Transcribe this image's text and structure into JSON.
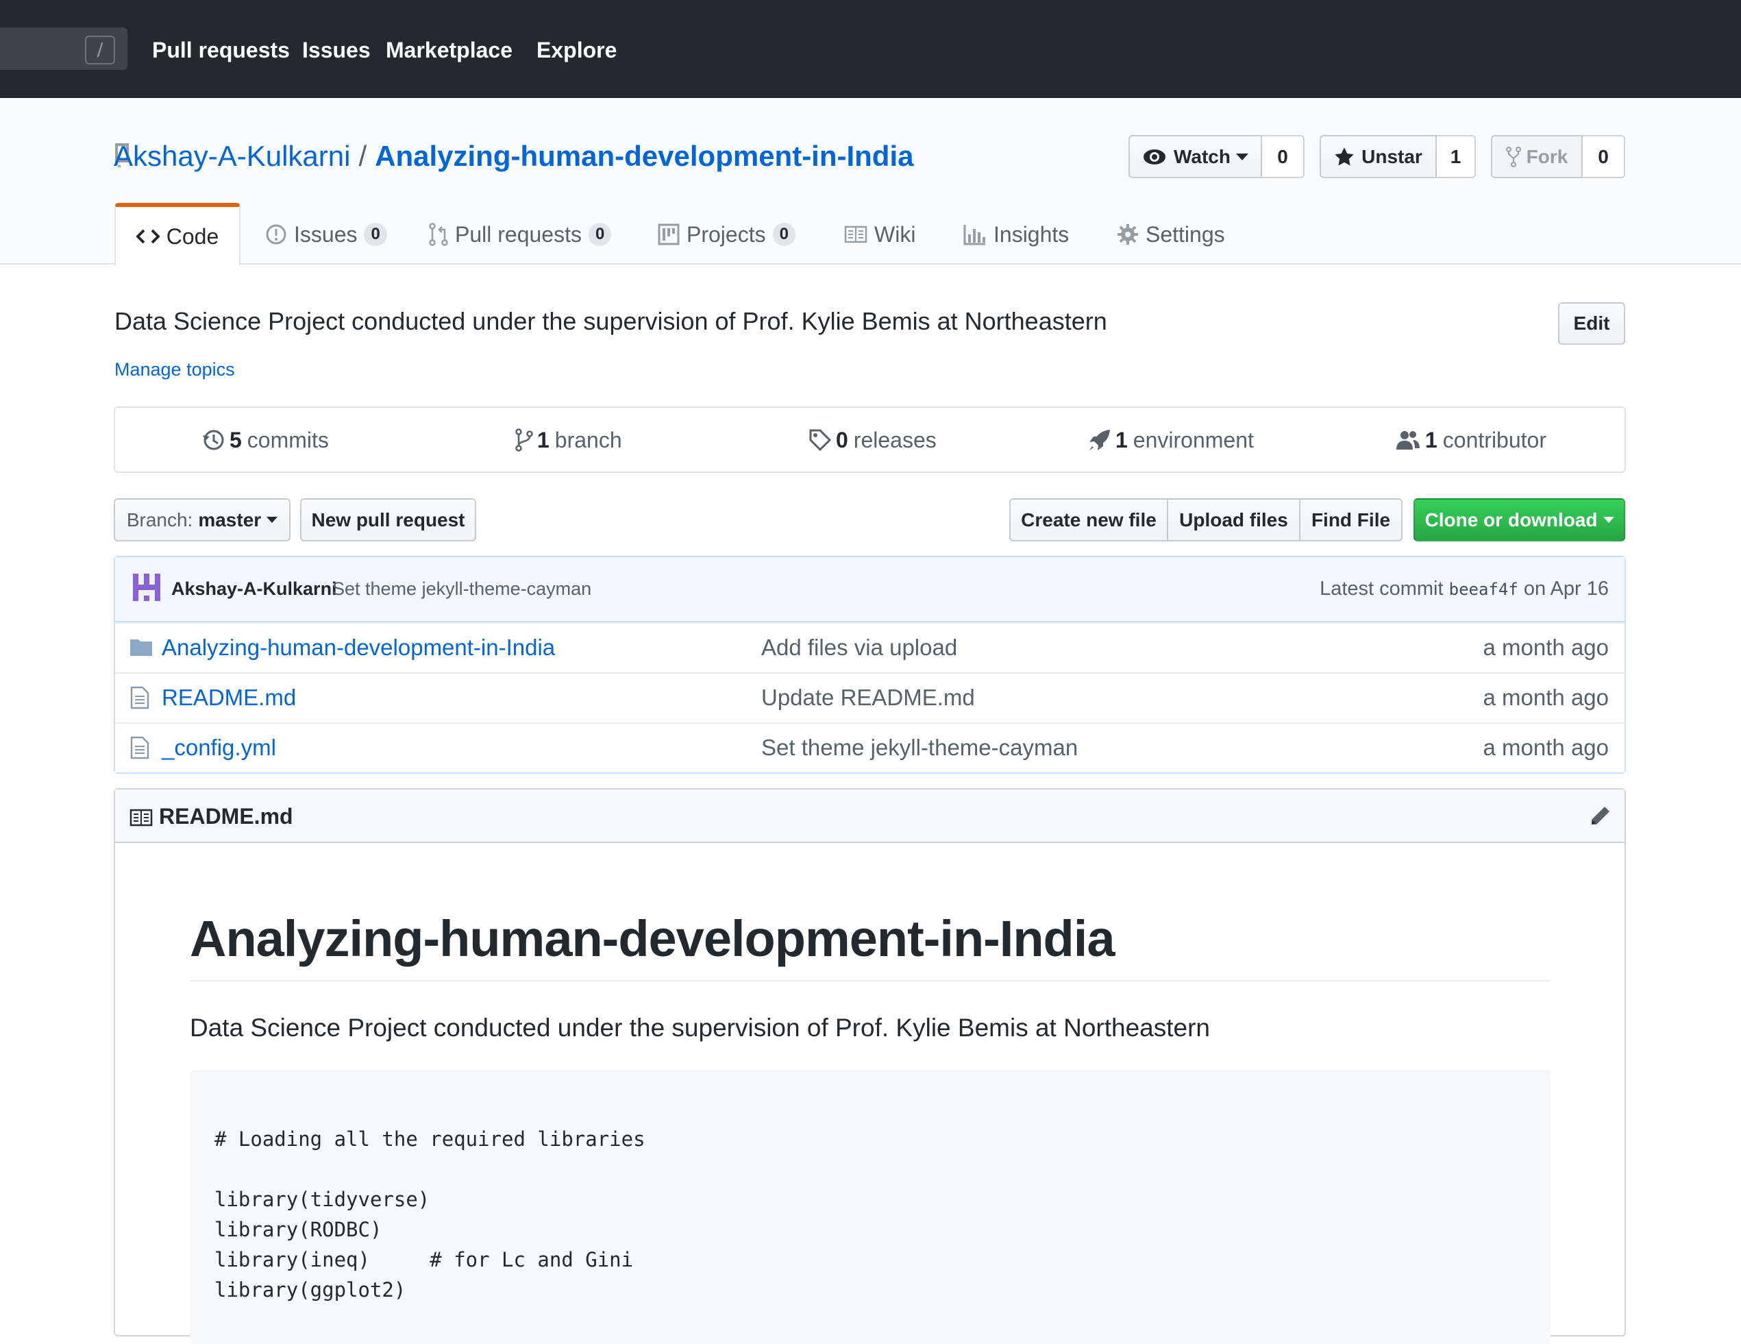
{
  "header": {
    "search_key": "/",
    "nav": [
      "Pull requests",
      "Issues",
      "Marketplace",
      "Explore"
    ]
  },
  "repo": {
    "owner": "Akshay-A-Kulkarni",
    "separator": "/",
    "name": "Analyzing-human-development-in-India",
    "watch_label": "Watch",
    "watch_count": "0",
    "star_label": "Unstar",
    "star_count": "1",
    "fork_label": "Fork",
    "fork_count": "0"
  },
  "tabs": [
    {
      "label": "Code",
      "icon": "code-icon"
    },
    {
      "label": "Issues",
      "count": "0",
      "icon": "issue-icon"
    },
    {
      "label": "Pull requests",
      "count": "0",
      "icon": "pull-request-icon"
    },
    {
      "label": "Projects",
      "count": "0",
      "icon": "project-icon"
    },
    {
      "label": "Wiki",
      "icon": "book-icon"
    },
    {
      "label": "Insights",
      "icon": "graph-icon"
    },
    {
      "label": "Settings",
      "icon": "gear-icon"
    }
  ],
  "description": "Data Science Project conducted under the supervision of Prof. Kylie Bemis at Northeastern",
  "manage_topics": "Manage topics",
  "edit_label": "Edit",
  "summary": [
    {
      "num": "5",
      "label": "commits",
      "icon": "history-icon"
    },
    {
      "num": "1",
      "label": "branch",
      "icon": "branch-icon"
    },
    {
      "num": "0",
      "label": "releases",
      "icon": "tag-icon"
    },
    {
      "num": "1",
      "label": "environment",
      "icon": "rocket-icon"
    },
    {
      "num": "1",
      "label": "contributor",
      "icon": "people-icon"
    }
  ],
  "actions": {
    "branch_prefix": "Branch:",
    "branch_name": "master",
    "new_pr": "New pull request",
    "create_file": "Create new file",
    "upload_files": "Upload files",
    "find_file": "Find File",
    "clone": "Clone or download"
  },
  "latest_commit": {
    "author": "Akshay-A-Kulkarni",
    "message": "Set theme jekyll-theme-cayman",
    "prefix": "Latest commit",
    "sha": "beeaf4f",
    "date": "on Apr 16"
  },
  "files": [
    {
      "type": "folder",
      "name": "Analyzing-human-development-in-India",
      "message": "Add files via upload",
      "age": "a month ago"
    },
    {
      "type": "file",
      "name": "README.md",
      "message": "Update README.md",
      "age": "a month ago"
    },
    {
      "type": "file",
      "name": "_config.yml",
      "message": "Set theme jekyll-theme-cayman",
      "age": "a month ago"
    }
  ],
  "readme": {
    "file_label": "README.md",
    "heading": "Analyzing-human-development-in-India",
    "paragraph": "Data Science Project conducted under the supervision of Prof. Kylie Bemis at Northeastern",
    "code_lines": [
      "# Loading all the required libraries",
      "",
      "library(tidyverse)",
      "library(RODBC)",
      "library(ineq)     # for Lc and Gini",
      "library(ggplot2)"
    ]
  },
  "colors": {
    "header_bg": "#24292e",
    "link": "#0366d6",
    "accent_tab": "#e36209",
    "clone_green": "#28a745"
  }
}
